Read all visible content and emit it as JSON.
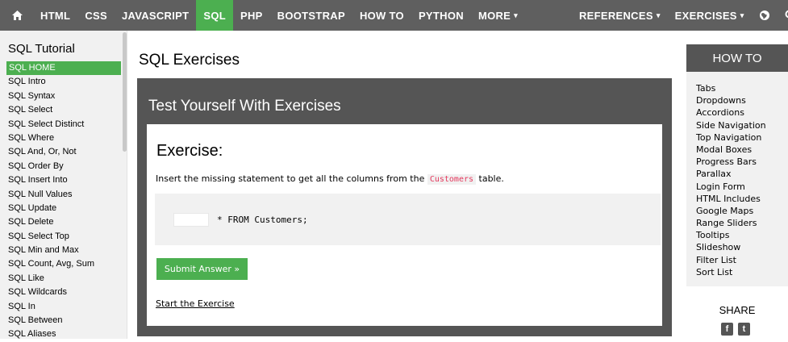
{
  "topnav": {
    "items": [
      "HTML",
      "CSS",
      "JAVASCRIPT",
      "SQL",
      "PHP",
      "BOOTSTRAP",
      "HOW TO",
      "PYTHON",
      "MORE"
    ],
    "right": [
      "REFERENCES",
      "EXERCISES"
    ],
    "home_icon": "home-icon",
    "globe_icon": "globe-icon",
    "search_icon": "search-icon",
    "active_color": "#4caf50",
    "bar_color": "#5f5f5f",
    "more_caret": "▾",
    "references_caret": "▾",
    "exercises_caret": "▾"
  },
  "sidebar": {
    "title": "SQL Tutorial",
    "links": [
      "SQL HOME",
      "SQL Intro",
      "SQL Syntax",
      "SQL Select",
      "SQL Select Distinct",
      "SQL Where",
      "SQL And, Or, Not",
      "SQL Order By",
      "SQL Insert Into",
      "SQL Null Values",
      "SQL Update",
      "SQL Delete",
      "SQL Select Top",
      "SQL Min and Max",
      "SQL Count, Avg, Sum",
      "SQL Like",
      "SQL Wildcards",
      "SQL In",
      "SQL Between",
      "SQL Aliases"
    ]
  },
  "main": {
    "title": "SQL Exercises",
    "panel_title": "Test Yourself With Exercises",
    "exercise_title": "Exercise:",
    "desc_before": "Insert the missing statement to get all the columns from the ",
    "desc_code": "Customers",
    "desc_after": " table.",
    "statement": "* FROM Customers;",
    "submit_label": "Submit Answer »",
    "start_link": "Start the Exercise"
  },
  "howto": {
    "title": "HOW TO",
    "items": [
      "Tabs",
      "Dropdowns",
      "Accordions",
      "Side Navigation",
      "Top Navigation",
      "Modal Boxes",
      "Progress Bars",
      "Parallax",
      "Login Form",
      "HTML Includes",
      "Google Maps",
      "Range Sliders",
      "Tooltips",
      "Slideshow",
      "Filter List",
      "Sort List"
    ]
  },
  "share": {
    "label": "SHARE",
    "facebook": "f",
    "twitter": "t"
  }
}
